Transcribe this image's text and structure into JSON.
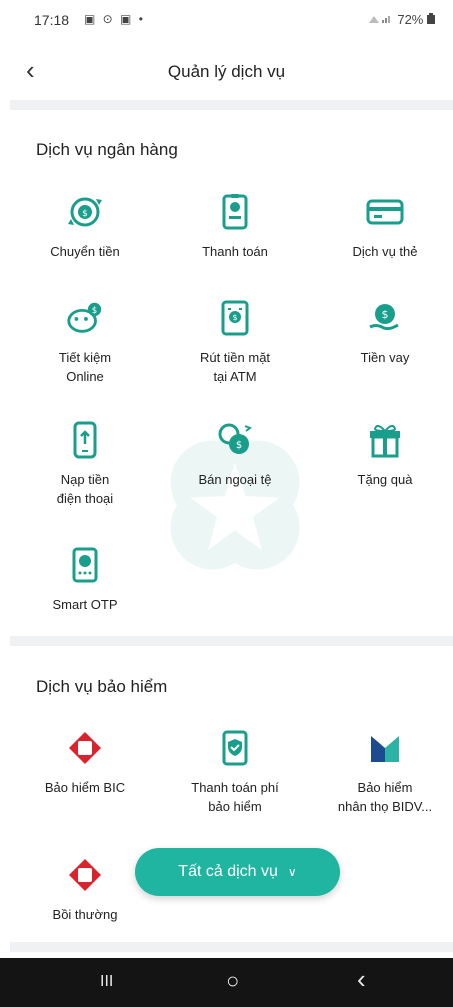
{
  "status_bar": {
    "time": "17:18",
    "notif_icons": "▣ ⊙ ▣ •",
    "battery": "72%"
  },
  "header": {
    "back": "‹",
    "title": "Quản lý dịch vụ"
  },
  "banking": {
    "title": "Dịch vụ ngân hàng",
    "items": [
      {
        "label": "Chuyển tiền",
        "icon": "transfer-icon"
      },
      {
        "label": "Thanh toán",
        "icon": "payment-icon"
      },
      {
        "label": "Dịch vụ thẻ",
        "icon": "card-icon"
      },
      {
        "label": "Tiết kiệm\nOnline",
        "icon": "piggy-bank-icon"
      },
      {
        "label": "Rút tiền mặt\ntại ATM",
        "icon": "atm-icon"
      },
      {
        "label": "Tiền vay",
        "icon": "loan-icon"
      },
      {
        "label": "Nạp tiền\nđiện thoại",
        "icon": "phone-topup-icon"
      },
      {
        "label": "Bán ngoại tệ",
        "icon": "foreign-currency-icon"
      },
      {
        "label": "Tặng quà",
        "icon": "gift-icon"
      },
      {
        "label": "Smart OTP",
        "icon": "smart-otp-icon"
      }
    ]
  },
  "insurance": {
    "title": "Dịch vụ bảo hiểm",
    "items": [
      {
        "label": "Bảo hiểm BIC",
        "icon": "bic-logo-icon"
      },
      {
        "label": "Thanh toán phí\nbảo hiểm",
        "icon": "insurance-payment-icon"
      },
      {
        "label": "Bảo hiểm\nnhân thọ BIDV...",
        "icon": "bidv-metlife-icon"
      },
      {
        "label": "Bồi thường",
        "icon": "claim-icon"
      }
    ]
  },
  "fab": {
    "label": "Tất cả dịch vụ",
    "chevron": "∨"
  },
  "nav_bar": {
    "recent": "III",
    "home": "○",
    "back": "‹"
  },
  "colors": {
    "accent": "#1fb5a0",
    "icon_teal": "#1a9e8c",
    "bic_red": "#d9232d",
    "bidv_blue": "#1c4b8f"
  }
}
